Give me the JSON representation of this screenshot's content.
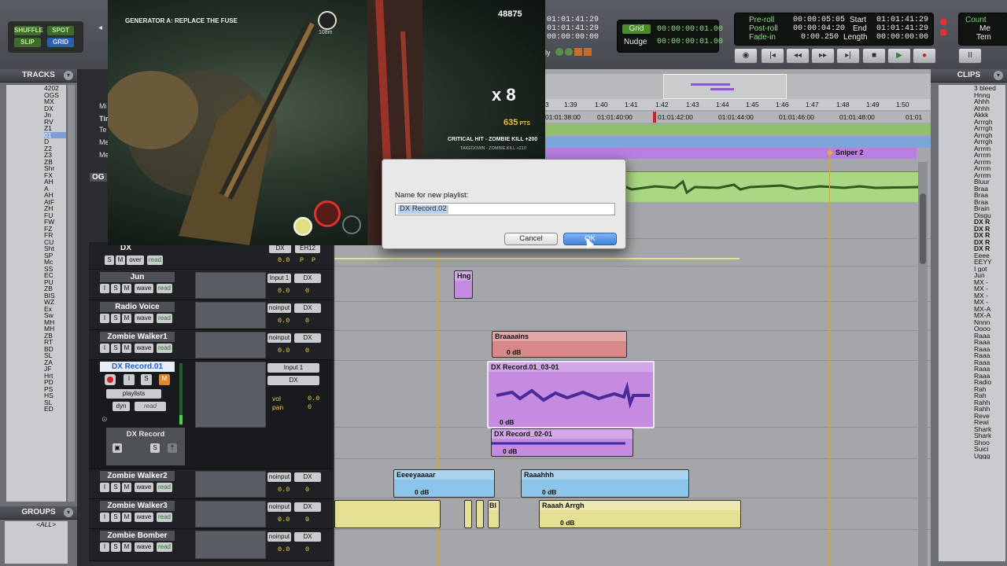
{
  "toolbar": {
    "modes": {
      "shuffle": "SHUFFLE",
      "spot": "SPOT",
      "slip": "SLIP",
      "grid": "GRID"
    },
    "counter": [
      "01:01:41:29",
      "01:01:41:29",
      "00:00:00:00"
    ],
    "grid_label": "Grid",
    "grid_value": "00:00:00:01.00",
    "nudge_label": "Nudge",
    "nudge_value": "00:00:00:01.00",
    "preroll_label": "Pre-roll",
    "preroll_value": "00:00:05:05",
    "postroll_label": "Post-roll",
    "postroll_value": "00:00:04:20",
    "fadein_label": "Fade-in",
    "fadein_value": "0:00.250",
    "start_label": "Start",
    "start_value": "01:01:41:29",
    "end_label": "End",
    "end_value": "01:01:41:29",
    "length_label": "Length",
    "length_value": "00:00:00:00",
    "count_label": "Count",
    "count_sub": [
      "Me",
      "Tem"
    ],
    "partial": "ly"
  },
  "tracks_panel": {
    "title": "TRACKS",
    "items": [
      "4202",
      "OGS",
      "MX",
      "DX",
      "Jn",
      "RV",
      "Z1",
      "01",
      "D",
      "Z2",
      "Z3",
      "ZB",
      "Shr",
      "FX",
      "AH",
      "A",
      "AH",
      "AtF",
      "ZH",
      "FU",
      "FW",
      "FZ",
      "FR",
      "CU",
      "Sht",
      "SP",
      "Mc",
      "SS",
      "EC",
      "PU",
      "ZB",
      "BIS",
      "WZ",
      "Ex",
      "Sw",
      "MH",
      "MH",
      "ZB",
      "RT",
      "BD",
      "SL",
      "ZA",
      "JF",
      "Hrt",
      "PD",
      "PS",
      "HS",
      "SL",
      "ED"
    ]
  },
  "groups_panel": {
    "title": "GROUPS",
    "item": "<ALL>"
  },
  "clips_panel": {
    "title": "CLIPS",
    "items": [
      "3 bleed",
      "Hnng",
      "Ahhh",
      "Ahhh",
      "Akkk",
      "Arrrgh",
      "Arrrgh",
      "Arrrgh",
      "Arrrgh",
      "Arrrm",
      "Arrrm",
      "Arrrm",
      "Arrrm",
      "Arrrm",
      "Bluur",
      "Braa",
      "Braa",
      "Braa",
      "Brain",
      "Disgu",
      "DX R",
      "DX R",
      "DX R",
      "DX R",
      "DX R",
      "Eeee",
      "EEYY",
      "I got",
      "Jun",
      "MX -",
      "MX -",
      "MX -",
      "MX -",
      "MX-A",
      "MX-A",
      "Nnnn",
      "Oooo",
      "Raaa",
      "Raaa",
      "Raaa",
      "Raaa",
      "Raaa",
      "Raaa",
      "Raaa",
      "Radio",
      "Rah",
      "Rah",
      "Rahh",
      "Rahh",
      "Reve",
      "Rewi",
      "Shark",
      "Shark",
      "Shoo",
      "Suici",
      "Uggg"
    ]
  },
  "ruler": {
    "bars": [
      "1:39",
      "1:40",
      "1:41",
      "1:42",
      "1:43",
      "1:44",
      "1:45",
      "1:46",
      "1:47",
      "1:48",
      "1:49",
      "1:50"
    ],
    "timecode": [
      "01:01:38:00",
      "01:01:40:00",
      "01:01:42:00",
      "01:01:44:00",
      "01:01:46:00",
      "01:01:48:00",
      "01:01"
    ],
    "marker": "Sniper 2",
    "partial_first": "3"
  },
  "edit_labels": {
    "mi": "Mi",
    "tir": "Tir",
    "te": "Te",
    "me": "Me",
    "me2": "Me",
    "og": "OG"
  },
  "tracks": [
    {
      "name": "DX",
      "input": "",
      "output": "",
      "over": "over",
      "read": "read",
      "vol": "0.0",
      "io1": "DX",
      "io2": "EH12",
      "p1": "P",
      "p2": "P"
    },
    {
      "name": "Jun",
      "io1": "Input 1",
      "io2": "DX",
      "mode": "wave",
      "auto": "read",
      "vol": "0.0",
      "pan": "0"
    },
    {
      "name": "Radio Voice",
      "io1": "noinput",
      "io2": "DX",
      "mode": "wave",
      "auto": "read",
      "vol": "0.0",
      "pan": "0"
    },
    {
      "name": "Zombie Walker1",
      "io1": "noinput",
      "io2": "DX",
      "mode": "wave",
      "auto": "read",
      "vol": "0.0",
      "pan": "0"
    },
    {
      "name": "DX Record.01",
      "io1": "Input 1",
      "io2": "DX",
      "playlists": "playlists",
      "dyn": "dyn",
      "auto": "read",
      "vol_label": "vol",
      "vol": "0.0",
      "pan_label": "pan",
      "pan": "0",
      "sub": "DX Record"
    },
    {
      "name": "Zombie Walker2",
      "io1": "noinput",
      "io2": "DX",
      "mode": "wave",
      "auto": "read",
      "vol": "0.0",
      "pan": "0"
    },
    {
      "name": "Zombie Walker3",
      "io1": "noinput",
      "io2": "DX",
      "mode": "wave",
      "auto": "read",
      "vol": "0.0",
      "pan": "0"
    },
    {
      "name": "Zombie Bomber",
      "io1": "noinput",
      "io2": "DX",
      "mode": "wave",
      "auto": "read",
      "vol": "0.0",
      "pan": "0"
    }
  ],
  "track_btn": {
    "i": "I",
    "s": "S",
    "m": "M"
  },
  "clips": {
    "hng": "Hng",
    "braaaains": "Braaaains",
    "braaaains_gain": "0 dB",
    "dx_record_01": "DX Record.01_03-01",
    "dx_record_01_gain": "0 dB",
    "dx_record_02": "DX Record_02-01",
    "dx_record_02_gain": "0 dB",
    "eeeeyaaaar": "Eeeeyaaaar",
    "eeeeyaaaar_gain": "0 dB",
    "raaahhh": "Raaahhh",
    "raaahhh_gain": "0 dB",
    "bl": "Bl",
    "raaah_arrgh": "Raaah Arrgh",
    "raaah_arrgh_gain": "0 dB"
  },
  "game": {
    "objective": "GENERATOR A: REPLACE THE FUSE",
    "score": "48875",
    "distance": "108m",
    "multiplier": "x 8",
    "points": "635",
    "points_unit": "PTS",
    "kill_line": "CRITICAL HIT - ZOMBIE KILL +200",
    "kill_sub": "TAKEDOWN - ZOMBIE KILL +210"
  },
  "dialog": {
    "label": "Name for new playlist:",
    "value": "DX Record.02",
    "cancel": "Cancel",
    "ok": "OK"
  },
  "colors": {
    "accent": "#4a8de0",
    "clip_purple": "#c48be0",
    "clip_red": "#d98888",
    "clip_blue": "#8cc4ea",
    "clip_yellow": "#e6e094",
    "clip_green": "#9fcf78"
  }
}
